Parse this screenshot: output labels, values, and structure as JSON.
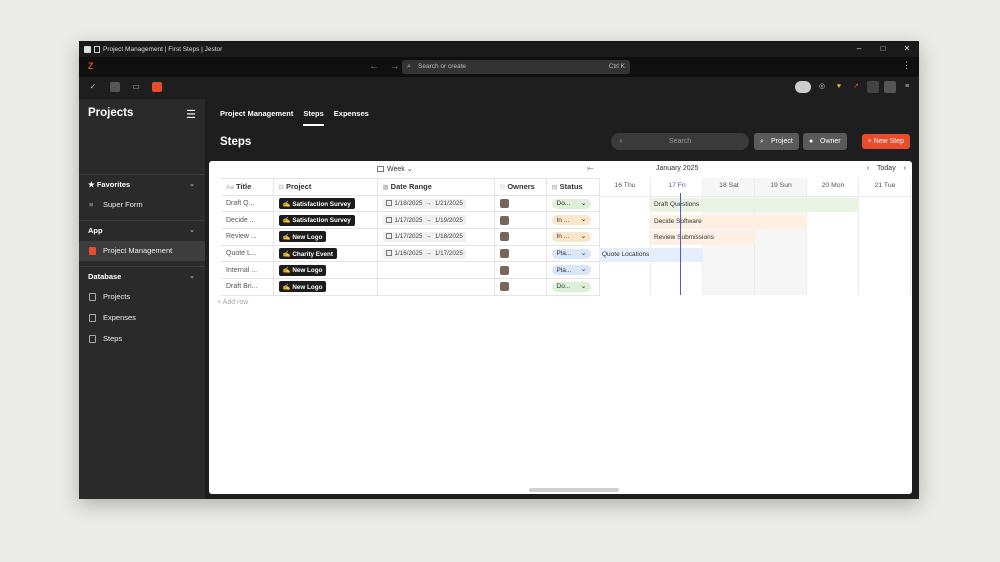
{
  "window": {
    "title": "Project Management | First Steps | Jestor",
    "controls": [
      "–",
      "□",
      "✕"
    ]
  },
  "addressbar": {
    "logo": "Z",
    "search_placeholder": "Search or create",
    "shortcut": "Ctrl K"
  },
  "sidebar": {
    "title": "Projects",
    "sections": [
      {
        "label": "Favorites",
        "items": [
          {
            "label": "Super Form"
          }
        ]
      },
      {
        "label": "App",
        "items": [
          {
            "label": "Project Management"
          }
        ]
      },
      {
        "label": "Database",
        "items": [
          {
            "label": "Projects"
          },
          {
            "label": "Expenses"
          },
          {
            "label": "Steps"
          }
        ]
      }
    ]
  },
  "tabs": [
    {
      "label": "Project Management"
    },
    {
      "label": "Steps"
    },
    {
      "label": "Expenses"
    }
  ],
  "page": {
    "title": "Steps",
    "search_placeholder": "Search",
    "project_button": "Project",
    "owner_button": "Owner",
    "new_step_button": "+ New Step"
  },
  "view": {
    "period": "Week",
    "add_row": "Add row"
  },
  "table": {
    "columns": [
      "Title",
      "Project",
      "Date Range",
      "Owners",
      "Status"
    ],
    "rows": [
      {
        "title": "Draft Q...",
        "project": "Satisfaction Survey",
        "start": "1/18/2025",
        "end": "1/21/2025",
        "status": "Do..."
      },
      {
        "title": "Decide ...",
        "project": "Satisfaction Survey",
        "start": "1/17/2025",
        "end": "1/19/2025",
        "status": "In ..."
      },
      {
        "title": "Review ...",
        "project": "New Logo",
        "start": "1/17/2025",
        "end": "1/18/2025",
        "status": "In ..."
      },
      {
        "title": "Quote L...",
        "project": "Charity Event",
        "start": "1/16/2025",
        "end": "1/17/2025",
        "status": "Pla..."
      },
      {
        "title": "Internal ...",
        "project": "New Logo",
        "start": "",
        "end": "",
        "status": "Pla..."
      },
      {
        "title": "Draft Bri...",
        "project": "New Logo",
        "start": "",
        "end": "",
        "status": "Do..."
      }
    ]
  },
  "gantt": {
    "month": "January 2025",
    "today_label": "Today",
    "days": [
      "16 Thu",
      "17 Fri",
      "18 Sat",
      "19 Sun",
      "20 Mon",
      "21 Tue"
    ],
    "bars": [
      {
        "label": "Draft Questions",
        "color": "#e9f3e4"
      },
      {
        "label": "Decide Software",
        "color": "#fdf0e2"
      },
      {
        "label": "Review Submissions",
        "color": "#fdf0e2"
      },
      {
        "label": "Quote Locations",
        "color": "#e5eefb"
      }
    ]
  }
}
